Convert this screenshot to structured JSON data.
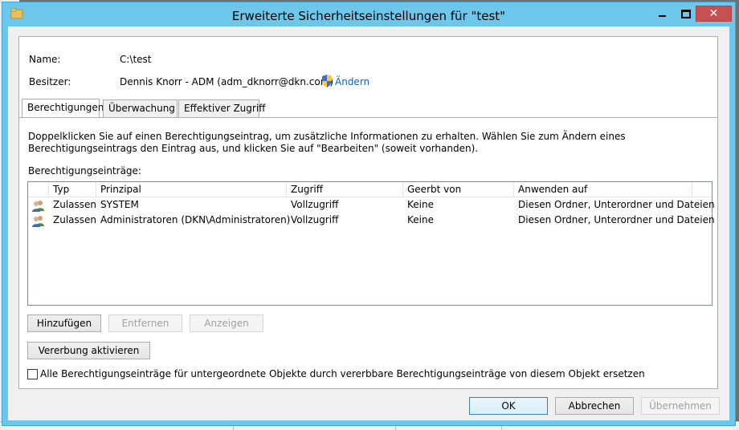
{
  "window": {
    "title": "Erweiterte Sicherheitseinstellungen für \"test\"",
    "close_glyph": "✕"
  },
  "owner_info": {
    "name_label": "Name:",
    "name_value": "C:\\test",
    "owner_label": "Besitzer:",
    "owner_value": "Dennis Knorr - ADM (adm_dknorr@dkn.com)",
    "change_link": "Ändern"
  },
  "tabs": [
    {
      "label": "Berechtigungen",
      "active": true
    },
    {
      "label": "Überwachung",
      "active": false
    },
    {
      "label": "Effektiver Zugriff",
      "active": false
    }
  ],
  "description": "Doppelklicken Sie auf einen Berechtigungseintrag, um zusätzliche Informationen zu erhalten. Wählen Sie zum Ändern eines Berechtigungseintrags den Eintrag aus, und klicken Sie auf \"Bearbeiten\" (soweit vorhanden).",
  "entries_label": "Berechtigungseinträge:",
  "table": {
    "columns": [
      "Typ",
      "Prinzipal",
      "Zugriff",
      "Geerbt von",
      "Anwenden auf"
    ],
    "rows": [
      [
        "Zulassen",
        "SYSTEM",
        "Vollzugriff",
        "Keine",
        "Diesen Ordner, Unterordner und Dateien"
      ],
      [
        "Zulassen",
        "Administratoren (DKN\\Administratoren)",
        "Vollzugriff",
        "Keine",
        "Diesen Ordner, Unterordner und Dateien"
      ]
    ]
  },
  "buttons": {
    "add": "Hinzufügen",
    "remove": "Entfernen",
    "view": "Anzeigen",
    "enable_inheritance": "Vererbung aktivieren",
    "ok": "OK",
    "cancel": "Abbrechen",
    "apply": "Übernehmen"
  },
  "replace_checkbox": {
    "label": "Alle Berechtigungseinträge für untergeordnete Objekte durch vererbbare Berechtigungseinträge von diesem Objekt ersetzen",
    "checked": false
  },
  "colors": {
    "titlebar": "#6dc7eb",
    "close_button": "#c75050",
    "link": "#0066cc"
  }
}
